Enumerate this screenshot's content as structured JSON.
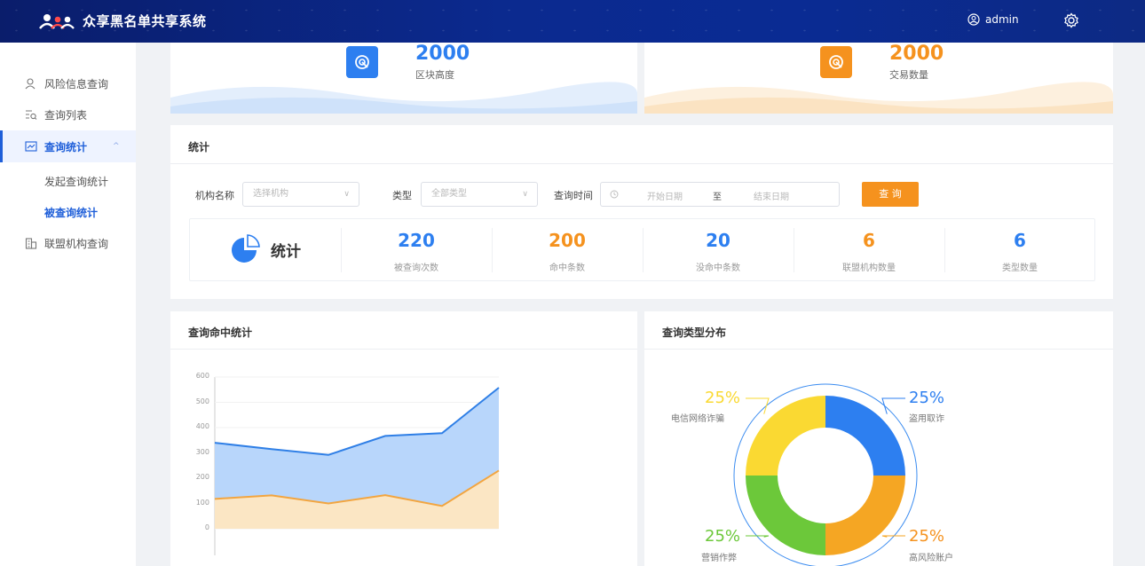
{
  "header": {
    "title": "众享黑名单共享系统",
    "user": "admin"
  },
  "sidebar": {
    "items": [
      {
        "label": "风险信息查询"
      },
      {
        "label": "查询列表"
      },
      {
        "label": "查询统计"
      },
      {
        "label": "联盟机构查询"
      }
    ],
    "subitems": [
      {
        "label": "发起查询统计"
      },
      {
        "label": "被查询统计"
      }
    ]
  },
  "stats": [
    {
      "value": "2000",
      "label": "区块高度",
      "color": "#2d7ff0"
    },
    {
      "value": "2000",
      "label": "交易数量",
      "color": "#f5921e"
    }
  ],
  "filter": {
    "title": "统计",
    "org_label": "机构名称",
    "org_placeholder": "选择机构",
    "type_label": "类型",
    "type_placeholder": "全部类型",
    "time_label": "查询时间",
    "start_placeholder": "开始日期",
    "to": "至",
    "end_placeholder": "结束日期",
    "query_button": "查 询"
  },
  "summary": {
    "label": "统计",
    "items": [
      {
        "value": "220",
        "label": "被查询次数",
        "color": "#2d7ff0"
      },
      {
        "value": "200",
        "label": "命中条数",
        "color": "#f5921e"
      },
      {
        "value": "20",
        "label": "没命中条数",
        "color": "#2d7ff0"
      },
      {
        "value": "6",
        "label": "联盟机构数量",
        "color": "#f5921e"
      },
      {
        "value": "6",
        "label": "类型数量",
        "color": "#2d7ff0"
      }
    ]
  },
  "chart_title": "查询命中统计",
  "pie_title": "查询类型分布",
  "chart_data": [
    {
      "type": "area",
      "yticks": [
        "0",
        "100",
        "200",
        "300",
        "400",
        "500",
        "600"
      ],
      "ylim": [
        0,
        600
      ],
      "series": [
        {
          "values": [
            340,
            315,
            292,
            367,
            378,
            558
          ],
          "color": "#2f7fe6",
          "fill": "#b8d6fb"
        },
        {
          "values": [
            118,
            132,
            100,
            133,
            90,
            230
          ],
          "color": "#f2a540",
          "fill": "#fbe6c4"
        }
      ]
    },
    {
      "type": "pie",
      "slices": [
        {
          "label": "盗用取诈",
          "pct": "25%",
          "value": 25,
          "color": "#2d7ff0"
        },
        {
          "label": "高风险账户",
          "pct": "25%",
          "value": 25,
          "color": "#f5a623"
        },
        {
          "label": "营销作弊",
          "pct": "25%",
          "value": 25,
          "color": "#6cc83a"
        },
        {
          "label": "电信网络诈骗",
          "pct": "25%",
          "value": 25,
          "color": "#fad932"
        }
      ]
    }
  ]
}
